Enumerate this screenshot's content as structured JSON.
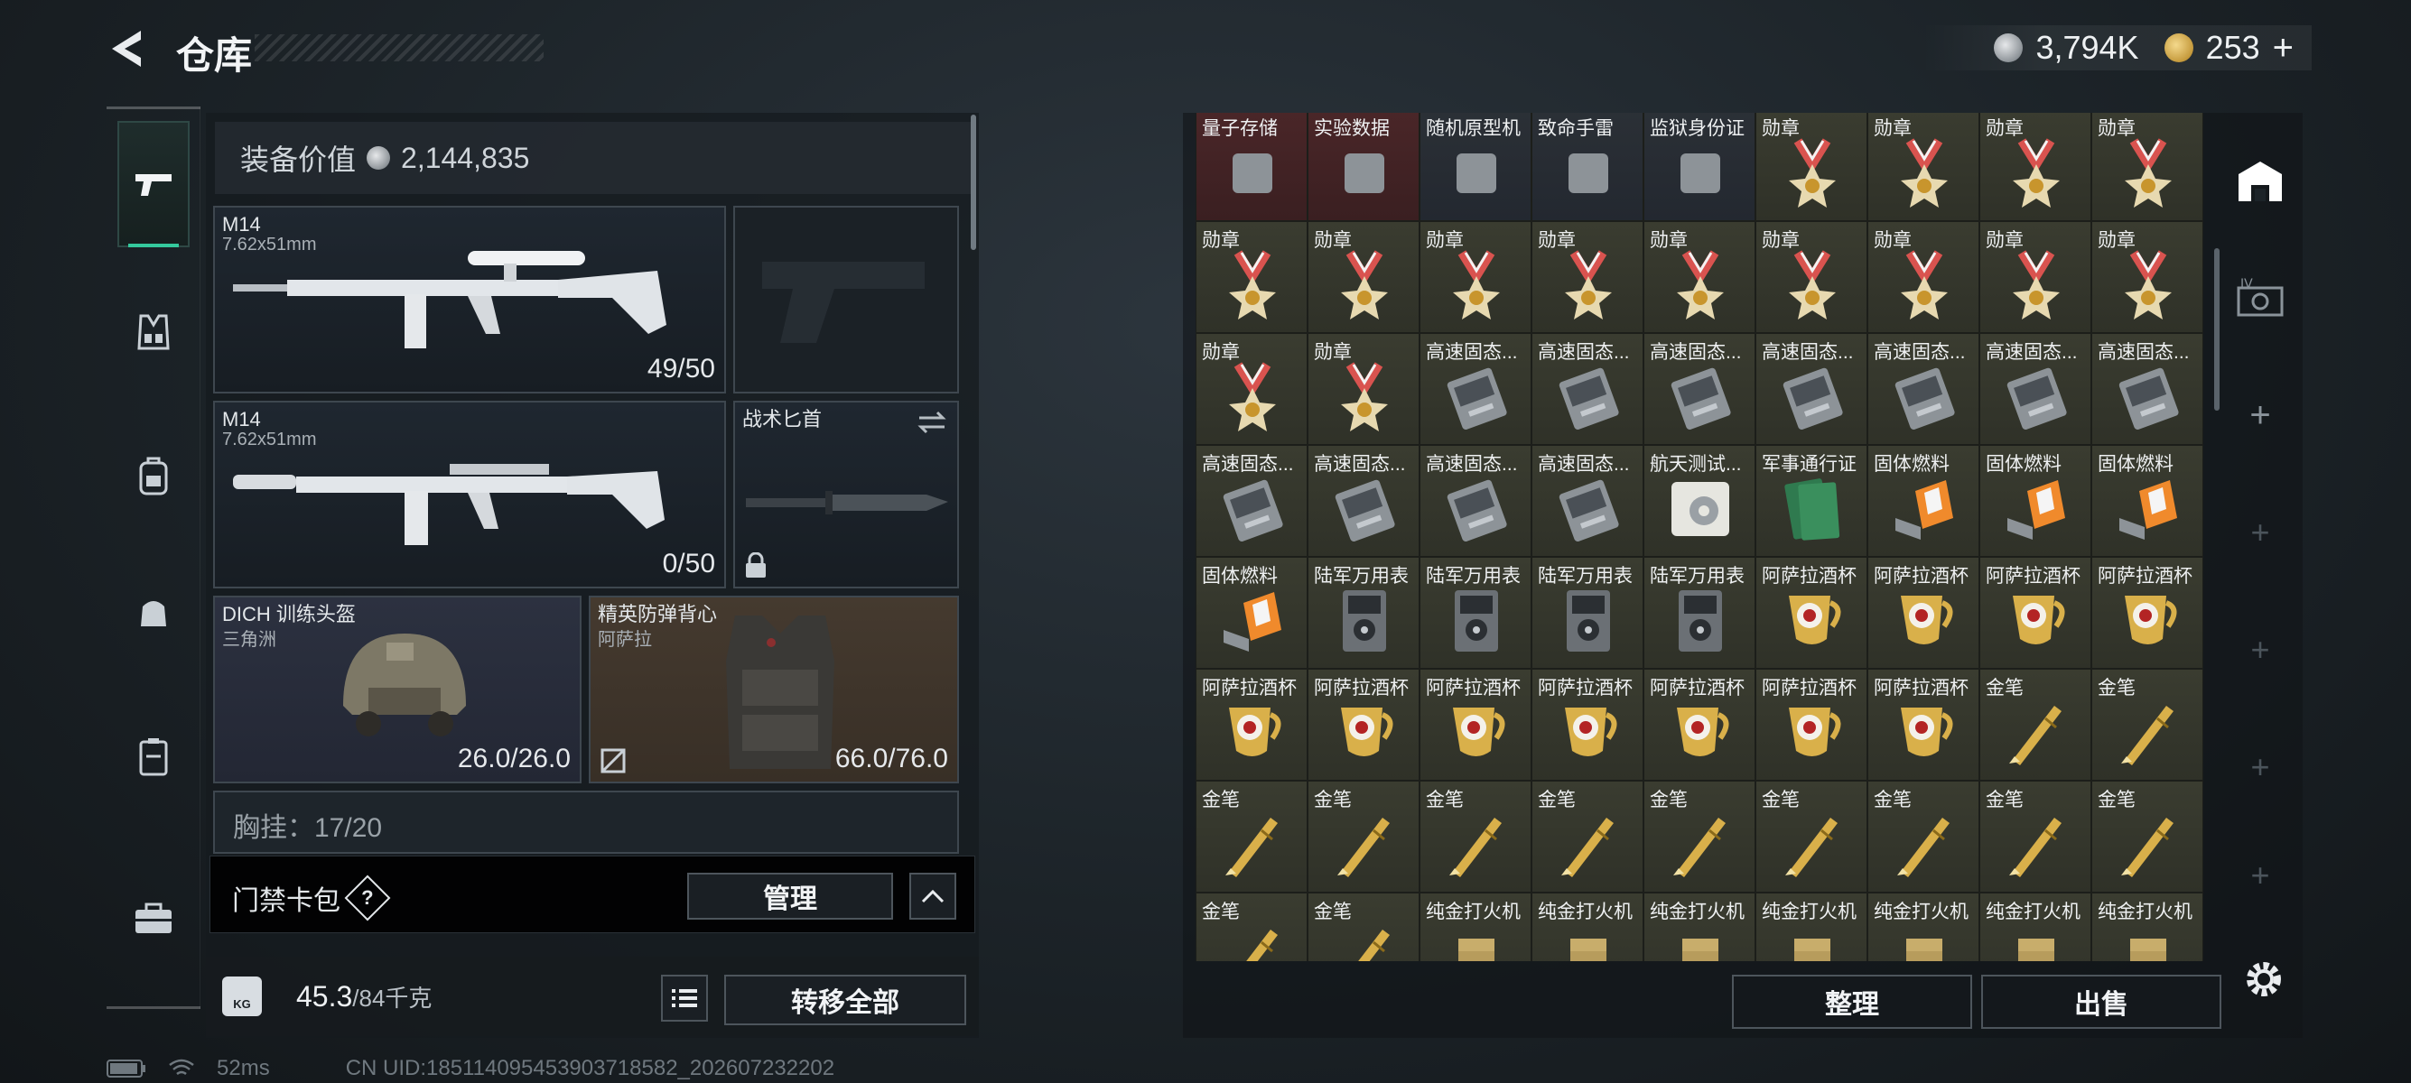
{
  "header": {
    "title": "仓库",
    "currency": [
      {
        "icon": "silver-coin-icon",
        "value": "3,794K"
      },
      {
        "icon": "gold-coin-icon",
        "value": "253"
      }
    ],
    "add_symbol": "+"
  },
  "loadout": {
    "equip_value_label": "装备价值",
    "equip_value": "2,144,835",
    "slots": {
      "primary1": {
        "name": "M14",
        "caliber": "7.62x51mm",
        "ammo": "49/50"
      },
      "primary2": {
        "name": "M14",
        "caliber": "7.62x51mm",
        "ammo": "0/50"
      },
      "melee": {
        "name": "战术匕首"
      },
      "helmet": {
        "name": "DICH 训练头盔",
        "sub": "三角洲",
        "durability": "26.0/26.0"
      },
      "armor": {
        "name": "精英防弹背心",
        "sub": "阿萨拉",
        "durability": "66.0/76.0"
      },
      "chest_rig": {
        "label": "胸挂：17/20",
        "hint": "?"
      }
    },
    "card_pack": {
      "label": "门禁卡包",
      "help": "?",
      "manage_label": "管理"
    },
    "weight": {
      "current": "45.3",
      "max_unit": "/84千克",
      "kg_badge": "KG"
    },
    "transfer_all_label": "转移全部"
  },
  "status": {
    "ping": "52ms",
    "uid": "CN UID:185114095453903718582_202607232202"
  },
  "storage": {
    "rows": [
      [
        "量子存储",
        "实验数据",
        "随机原型机",
        "致命手雷",
        "监狱身份证",
        "勋章",
        "勋章",
        "勋章",
        "勋章"
      ],
      [
        "勋章",
        "勋章",
        "勋章",
        "勋章",
        "勋章",
        "勋章",
        "勋章",
        "勋章",
        "勋章"
      ],
      [
        "勋章",
        "勋章",
        "高速固态...",
        "高速固态...",
        "高速固态...",
        "高速固态...",
        "高速固态...",
        "高速固态...",
        "高速固态..."
      ],
      [
        "高速固态...",
        "高速固态...",
        "高速固态...",
        "高速固态...",
        "航天测试...",
        "军事通行证",
        "固体燃料",
        "固体燃料",
        "固体燃料"
      ],
      [
        "固体燃料",
        "陆军万用表",
        "陆军万用表",
        "陆军万用表",
        "陆军万用表",
        "阿萨拉酒杯",
        "阿萨拉酒杯",
        "阿萨拉酒杯",
        "阿萨拉酒杯"
      ],
      [
        "阿萨拉酒杯",
        "阿萨拉酒杯",
        "阿萨拉酒杯",
        "阿萨拉酒杯",
        "阿萨拉酒杯",
        "阿萨拉酒杯",
        "阿萨拉酒杯",
        "金笔",
        "金笔"
      ],
      [
        "金笔",
        "金笔",
        "金笔",
        "金笔",
        "金笔",
        "金笔",
        "金笔",
        "金笔",
        "金笔"
      ],
      [
        "金笔",
        "金笔",
        "纯金打火机",
        "纯金打火机",
        "纯金打火机",
        "纯金打火机",
        "纯金打火机",
        "纯金打火机",
        "纯金打火机"
      ]
    ],
    "sort_label": "整理",
    "sell_label": "出售"
  },
  "colors": {
    "accent_green": "#34c99d",
    "cell_olive": "#3a3c30",
    "cell_red": "#4a2628"
  }
}
